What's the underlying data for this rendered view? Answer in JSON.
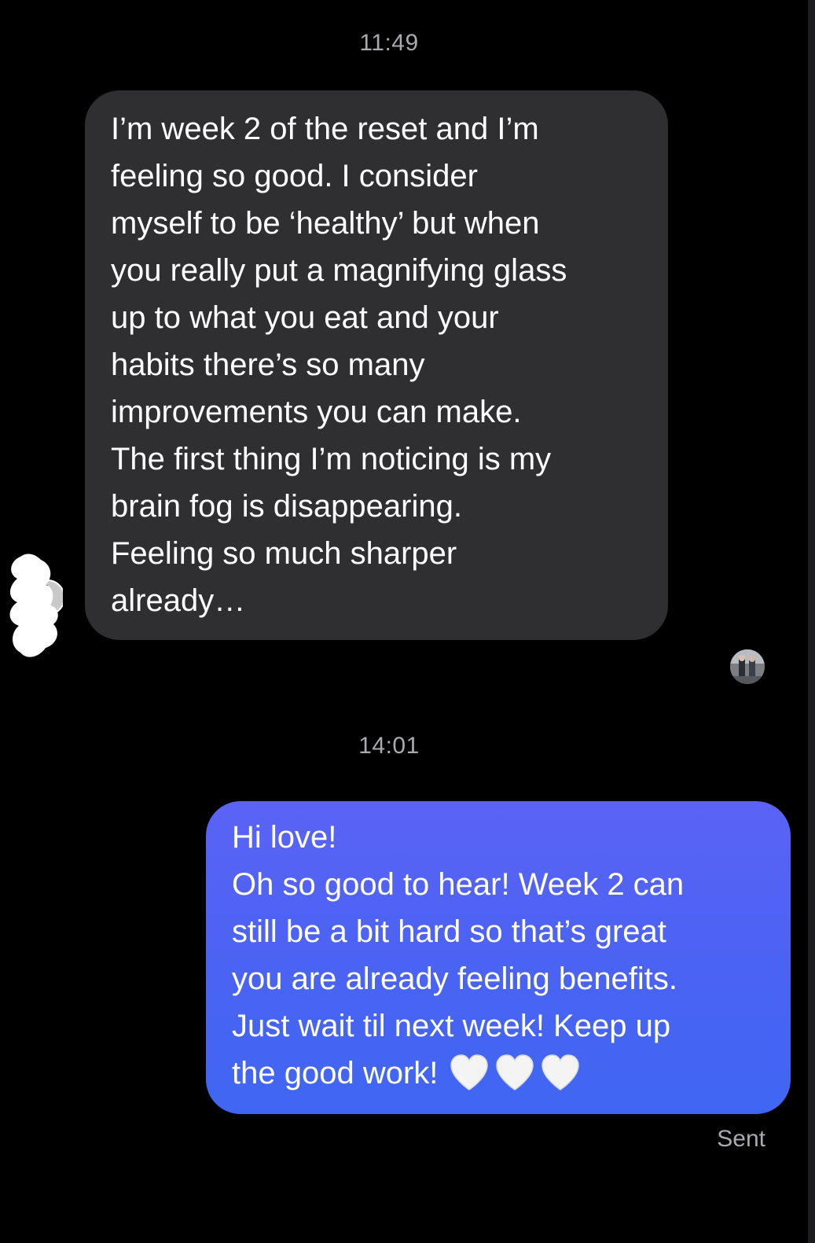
{
  "conversation": {
    "timestamps": [
      "11:49",
      "14:01"
    ],
    "incoming": {
      "lines": [
        "I’m week 2 of the reset and I’m",
        "feeling so good. I consider",
        "myself to be ‘healthy’ but when",
        "you really put a magnifying glass",
        "up to what you eat and your",
        "habits there’s so many",
        "improvements you can make.",
        "The first thing I’m noticing is my",
        "brain fog is disappearing.",
        "Feeling so much sharper",
        "already…"
      ]
    },
    "outgoing": {
      "lines": [
        "Hi love!",
        "Oh so good to hear! Week 2 can",
        "still be a bit hard so that’s great",
        "you are already feeling benefits.",
        "Just wait til next week! Keep up",
        "the good work!"
      ],
      "emoji": [
        "white-heart",
        "white-heart",
        "white-heart"
      ]
    },
    "status": "Sent"
  },
  "colors": {
    "background": "#000000",
    "incoming_bubble": "#2f2f31",
    "outgoing_bubble": "#4a63f2",
    "meta_text": "#a9a9b0"
  },
  "icons": {
    "incoming_avatar": "avatar-icon",
    "read_receipt_avatar": "avatar-icon",
    "heart": "white-heart-icon"
  }
}
